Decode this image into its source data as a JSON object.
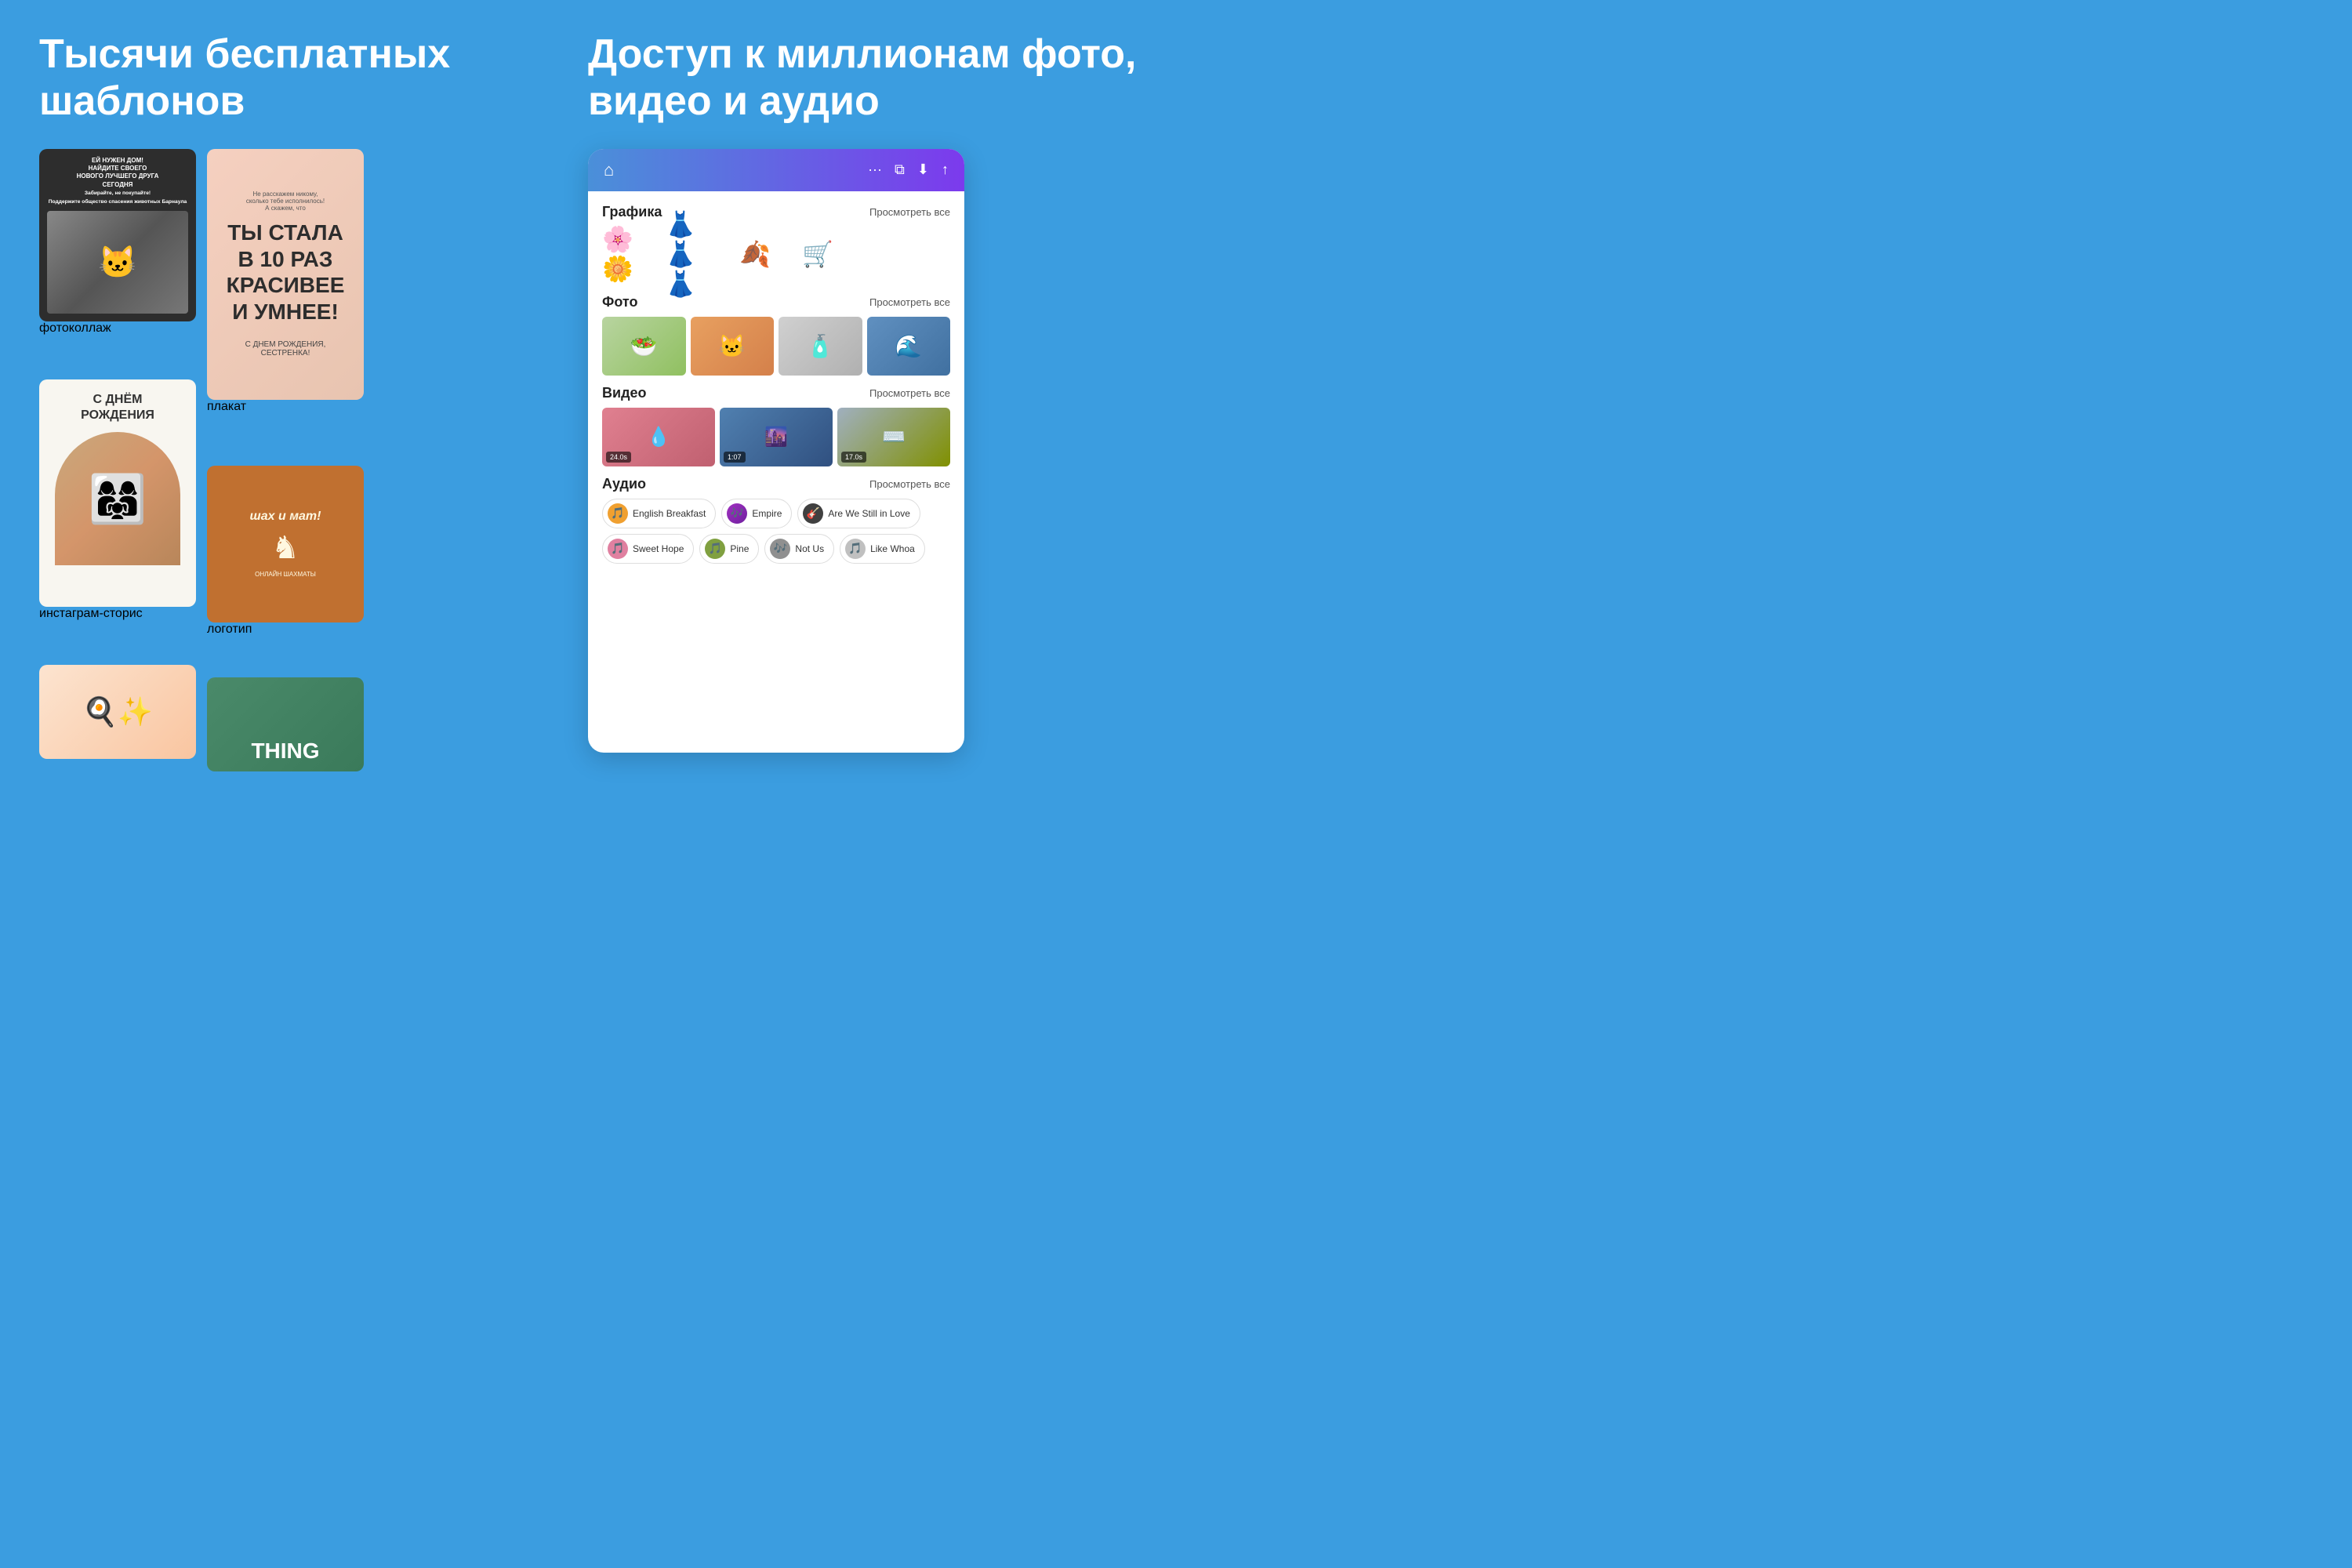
{
  "left": {
    "title": "Тысячи бесплатных шаблонов",
    "cards": [
      {
        "id": "cat-collage",
        "label": "фотоколлаж",
        "title_text": "ЕЙ НУЖЕН ДОМ!\nНАЙДИТЕ СВОЕГО\nНОВОГО ЛУЧШЕГО ДРУГА\nСЕГОДНЯ",
        "sub_text": "Забирайте, не покупайте!\nПоддержите общество спасения животных Барнаула"
      },
      {
        "id": "birthday",
        "label": "инстаграм-сторис",
        "title_text": "С ДНЁМ\nРОЖДЕНИЯ"
      },
      {
        "id": "poster",
        "label": "плакат",
        "main_text": "ТЫ СТАЛА\nВ 10 РАЗ\nКРАСИВЕЕ\nИ УМНЕЕ!",
        "sub_text": "С ДНЕМ РОЖДЕНИЯ,\nСЕСТРЕНКА!",
        "top_text": "Не расскажем никому,\nсколько тебе исполнилось!\nА скажем, что"
      },
      {
        "id": "logo",
        "label": "логотип",
        "main_text": "шах и мат!",
        "sub_text": "ОНЛАЙН            ШАХМАТЫ"
      }
    ],
    "partial_cards": [
      {
        "id": "partial-top",
        "text": "THING"
      },
      {
        "id": "partial-bottom",
        "emoji": "🍳"
      }
    ]
  },
  "right": {
    "title": "Доступ к миллионам фото, видео и аудио",
    "phone": {
      "header_icons": [
        "⌂",
        "···",
        "⬜",
        "⬇",
        "↑"
      ],
      "sections": [
        {
          "id": "graphics",
          "title": "Графика",
          "view_all": "Просмотреть все",
          "items": [
            {
              "id": "flowers",
              "emoji": "🌸"
            },
            {
              "id": "people",
              "emoji": "👗"
            },
            {
              "id": "leaves",
              "emoji": "🍂"
            },
            {
              "id": "vendor",
              "emoji": "🛒"
            }
          ]
        },
        {
          "id": "photos",
          "title": "Фото",
          "view_all": "Просмотреть все",
          "items": [
            {
              "id": "food",
              "emoji": "🥗",
              "style": "food"
            },
            {
              "id": "cat",
              "emoji": "🐱",
              "style": "cat"
            },
            {
              "id": "bottle",
              "emoji": "🧴",
              "style": "bottle"
            },
            {
              "id": "sea",
              "emoji": "🌊",
              "style": "sea"
            }
          ]
        },
        {
          "id": "videos",
          "title": "Видео",
          "view_all": "Просмотреть все",
          "items": [
            {
              "id": "vid1",
              "duration": "24.0s",
              "emoji": "💧",
              "style": "pink"
            },
            {
              "id": "vid2",
              "duration": "1:07",
              "emoji": "🌆",
              "style": "city"
            },
            {
              "id": "vid3",
              "duration": "17.0s",
              "emoji": "⌨",
              "style": "keyboard"
            }
          ]
        },
        {
          "id": "audio",
          "title": "Аудио",
          "view_all": "Просмотреть все",
          "chips": [
            {
              "id": "english-breakfast",
              "label": "English Breakfast",
              "icon": "🎵",
              "color": "orange"
            },
            {
              "id": "empire",
              "label": "Empire",
              "icon": "🎶",
              "color": "purple"
            },
            {
              "id": "are-we-still",
              "label": "Are We Still in Love",
              "icon": "🎸",
              "color": "dark"
            },
            {
              "id": "sweet-hope",
              "label": "Sweet Hope",
              "icon": "🎵",
              "color": "pink"
            },
            {
              "id": "pine",
              "label": "Pine",
              "icon": "🎵",
              "color": "green"
            },
            {
              "id": "not-us",
              "label": "Not Us",
              "icon": "🎶",
              "color": "gray"
            },
            {
              "id": "like-whoa",
              "label": "Like Whoa",
              "icon": "🎵",
              "color": "lightgray"
            }
          ]
        }
      ]
    }
  }
}
